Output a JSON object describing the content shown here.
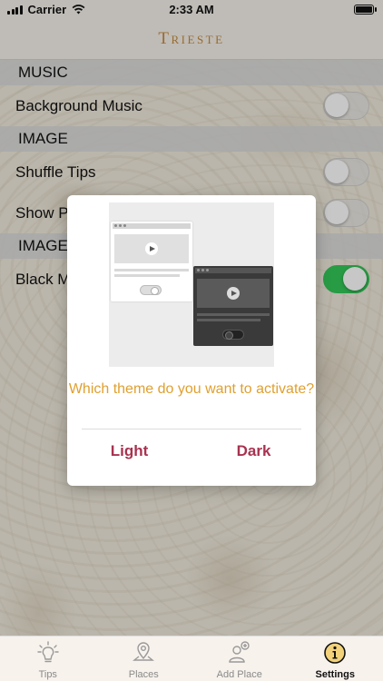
{
  "status_bar": {
    "carrier": "Carrier",
    "time": "2:33 AM"
  },
  "nav": {
    "title": "Trieste"
  },
  "sections": [
    {
      "header": "MUSIC",
      "rows": [
        {
          "label": "Background Music",
          "toggle": "off"
        }
      ]
    },
    {
      "header": "IMAGE",
      "rows": [
        {
          "label": "Shuffle Tips",
          "toggle": "off"
        },
        {
          "label": "Show Pictures",
          "toggle": "off"
        }
      ]
    },
    {
      "header": "IMAGE",
      "rows": [
        {
          "label": "Black Mode",
          "toggle": "on"
        }
      ]
    }
  ],
  "dialog": {
    "question": "Which theme do you want to activate?",
    "light_button": "Light",
    "dark_button": "Dark"
  },
  "tabs": [
    {
      "label": "Tips",
      "icon": "lightbulb-icon"
    },
    {
      "label": "Places",
      "icon": "map-pin-icon"
    },
    {
      "label": "Add Place",
      "icon": "add-person-icon"
    },
    {
      "label": "Settings",
      "icon": "info-icon",
      "active": true
    }
  ],
  "colors": {
    "accent": "#c58b3c",
    "dialog_button": "#a8324f",
    "question": "#e0a030",
    "toggle_on": "#34c759"
  }
}
